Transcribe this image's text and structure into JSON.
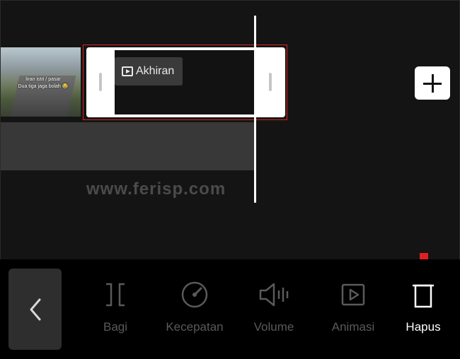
{
  "timeline": {
    "video_caption_1": "liran istri / pasar",
    "video_caption_2": "Dua tiga jaga bolah 😂",
    "ending_clip_label": "Akhiran",
    "watermark": "www.ferisp.com"
  },
  "toolbar": {
    "back_icon": "chevron-left-icon",
    "items": [
      {
        "label": "Bagi",
        "icon": "split-icon",
        "active": false
      },
      {
        "label": "Kecepatan",
        "icon": "speedometer-icon",
        "active": false
      },
      {
        "label": "Volume",
        "icon": "volume-icon",
        "active": false
      },
      {
        "label": "Animasi",
        "icon": "play-box-icon",
        "active": false
      },
      {
        "label": "Hapus",
        "icon": "trash-icon",
        "active": true
      }
    ]
  },
  "colors": {
    "background": "#141414",
    "highlight_red": "#e02020",
    "inactive_text": "#5a5a5a",
    "active_text": "#ffffff"
  }
}
